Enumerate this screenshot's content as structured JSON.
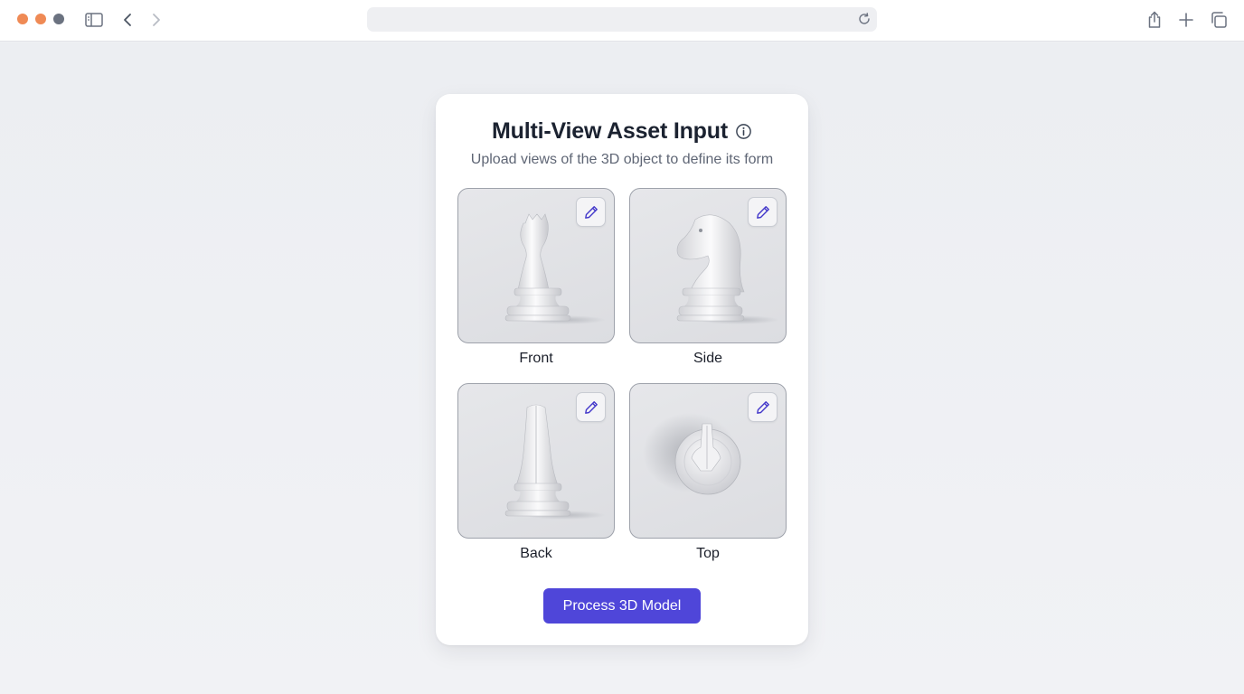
{
  "browser": {
    "icons": [
      "sidebar-icon",
      "back-icon",
      "forward-icon",
      "reload-icon",
      "share-icon",
      "new-tab-icon",
      "tabs-overview-icon"
    ]
  },
  "card": {
    "title": "Multi-View Asset Input",
    "subtitle": "Upload views of the 3D object to define its form",
    "views": [
      {
        "label": "Front"
      },
      {
        "label": "Side"
      },
      {
        "label": "Back"
      },
      {
        "label": "Top"
      }
    ],
    "process_button": "Process 3D Model"
  },
  "colors": {
    "accent": "#4f46d9",
    "edit_icon": "#4338ca",
    "window_close": "#ef8a55",
    "window_minimize": "#ef8a55",
    "window_zoom": "#6b7280"
  }
}
